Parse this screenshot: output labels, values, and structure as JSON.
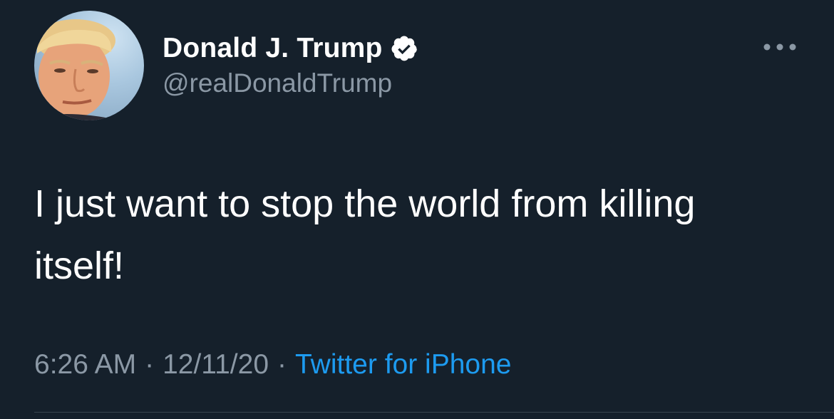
{
  "tweet": {
    "author": {
      "display_name": "Donald J. Trump",
      "handle": "@realDonaldTrump",
      "verified": true,
      "avatar_icon": "profile-photo"
    },
    "text": "I just want to stop the world from killing itself!",
    "time": "6:26 AM",
    "date": "12/11/20",
    "separator": "·",
    "source": "Twitter for iPhone"
  },
  "colors": {
    "background": "#15202b",
    "text_primary": "#ffffff",
    "text_secondary": "#8b98a5",
    "link": "#1d9bf0",
    "divider": "#38444d"
  },
  "icons": {
    "verified": "verified-badge-icon",
    "more": "more-options-icon"
  }
}
